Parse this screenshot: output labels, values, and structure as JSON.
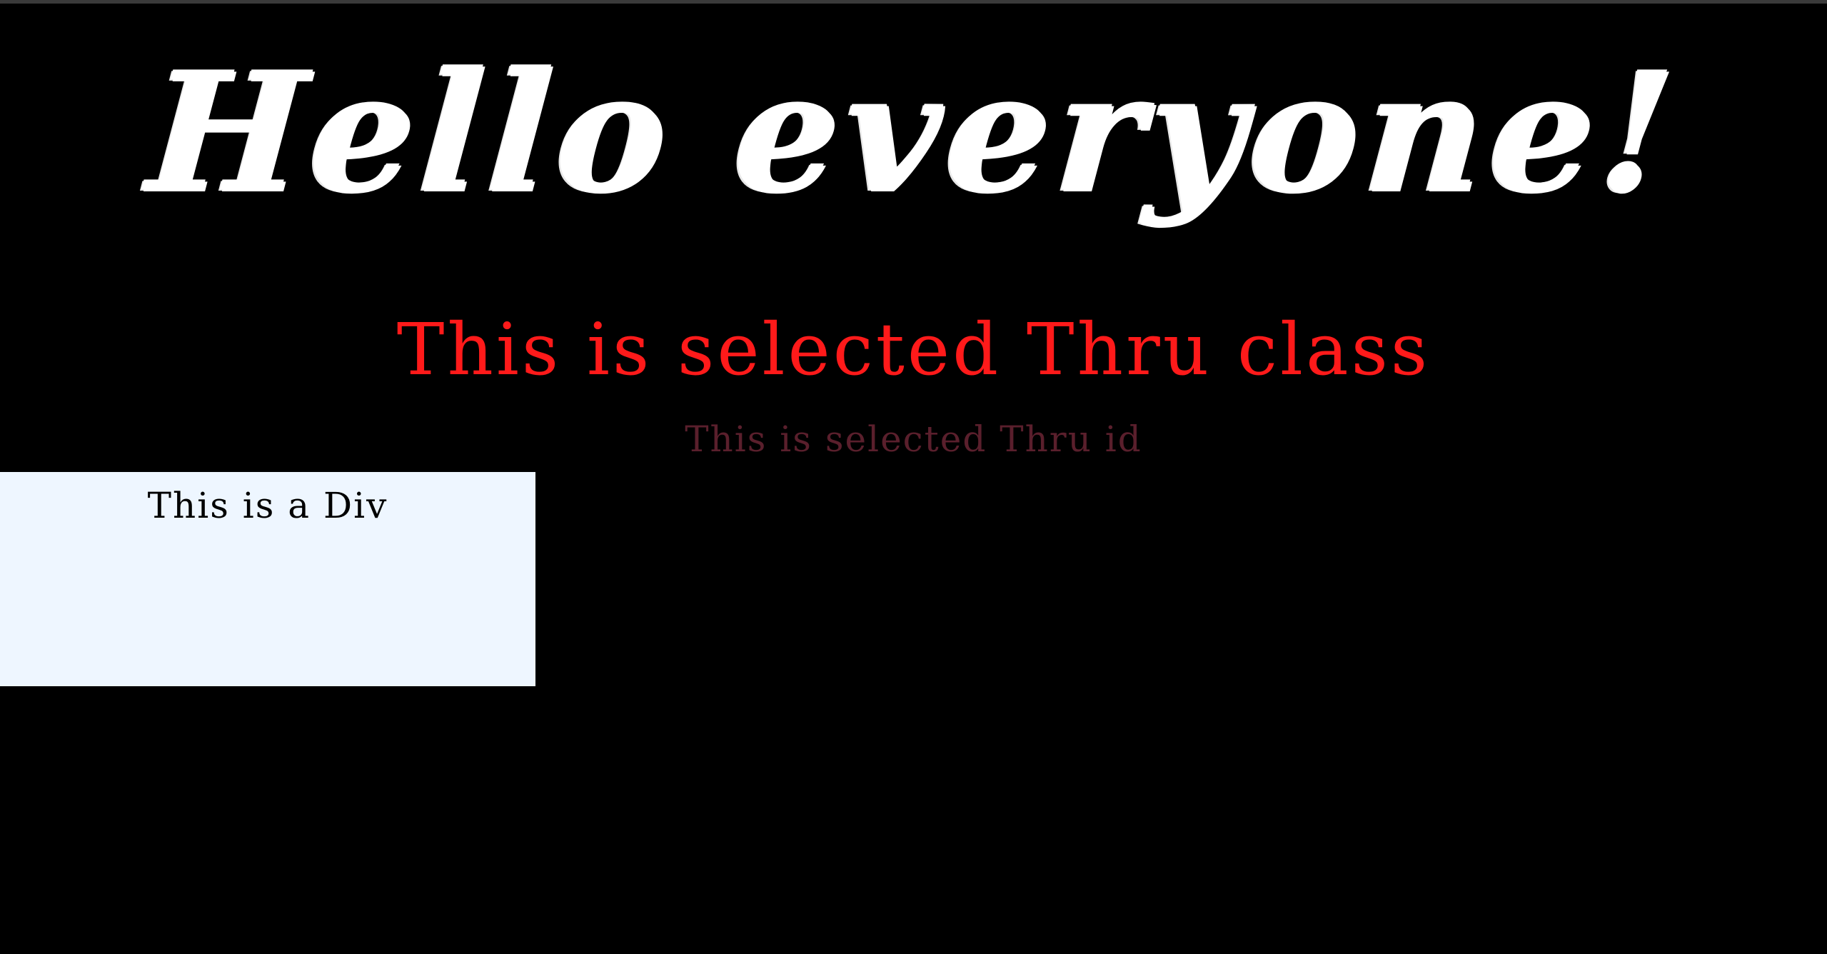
{
  "page": {
    "background": "#000000"
  },
  "heading": {
    "text": "Hello everyone!",
    "color": "#ffffff"
  },
  "class_paragraph": {
    "text": "This is selected Thru class",
    "color": "#ff1a1a"
  },
  "id_paragraph": {
    "text": "This is selected Thru id",
    "color": "#5a1f2c"
  },
  "div_box": {
    "label": "This is a Div",
    "background": "#eef6ff"
  }
}
